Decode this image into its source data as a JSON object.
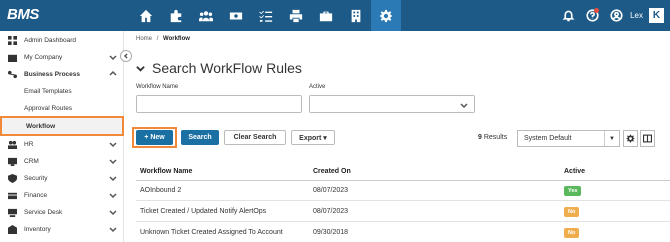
{
  "app": {
    "brand": "BMS"
  },
  "topbar": {
    "nav_icons": [
      "home-icon",
      "puzzle-icon",
      "users-icon",
      "money-icon",
      "checklist-icon",
      "printer-icon",
      "briefcase-icon",
      "building-icon",
      "gear-icon"
    ],
    "active_icon": "gear-icon",
    "username": "Lex",
    "logo_letter": "K"
  },
  "sidebar": {
    "items": [
      {
        "label": "Admin Dashboard",
        "icon": "dashboard-icon"
      },
      {
        "label": "My Company",
        "icon": "building-icon",
        "chevron": "down"
      },
      {
        "label": "Business Process",
        "icon": "process-icon",
        "chevron": "up",
        "bold": true
      },
      {
        "label": "Email Templates",
        "sub": true
      },
      {
        "label": "Approval Routes",
        "sub": true
      },
      {
        "label": "Workflow",
        "sub": true,
        "active": true
      },
      {
        "label": "HR",
        "icon": "hr-icon",
        "chevron": "down"
      },
      {
        "label": "CRM",
        "icon": "crm-icon",
        "chevron": "down"
      },
      {
        "label": "Security",
        "icon": "shield-icon",
        "chevron": "down"
      },
      {
        "label": "Finance",
        "icon": "finance-icon",
        "chevron": "down"
      },
      {
        "label": "Service Desk",
        "icon": "service-desk-icon",
        "chevron": "down"
      },
      {
        "label": "Inventory",
        "icon": "inventory-icon",
        "chevron": "down"
      }
    ]
  },
  "breadcrumb": {
    "home": "Home",
    "separator": "/",
    "current": "Workflow"
  },
  "page": {
    "title": "Search WorkFlow Rules"
  },
  "filters": {
    "workflow_name_label": "Workflow Name",
    "workflow_name_value": "",
    "active_label": "Active",
    "active_value": ""
  },
  "toolbar": {
    "new_label": "+ New",
    "search_label": "Search",
    "clear_label": "Clear Search",
    "export_label": "Export ▾",
    "results_count": "9",
    "results_label": "Results",
    "view_select": "System Default"
  },
  "table": {
    "headers": {
      "name": "Workflow Name",
      "created": "Created On",
      "active": "Active"
    },
    "rows": [
      {
        "name": "AOInbound 2",
        "created": "08/07/2023",
        "active": "Yes"
      },
      {
        "name": "Ticket Created / Updated Notify AlertOps",
        "created": "08/07/2023",
        "active": "No"
      },
      {
        "name": "Unknown Ticket Created Assigned To Account",
        "created": "09/30/2018",
        "active": "No"
      }
    ]
  },
  "colors": {
    "topbar": "#1d5a87",
    "primary_button": "#1a6fa3",
    "highlight": "#f08a3a",
    "badge_yes": "#5cb85c",
    "badge_no": "#f0ad4e"
  }
}
